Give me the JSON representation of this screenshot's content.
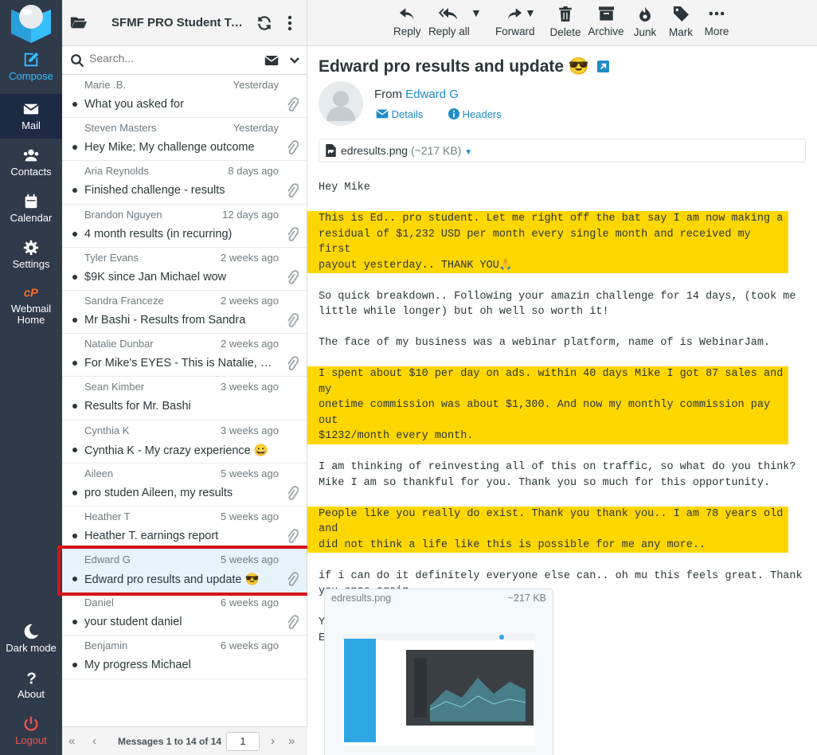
{
  "nav": {
    "items": [
      {
        "label": "Compose",
        "icon": "compose-icon"
      },
      {
        "label": "Mail",
        "icon": "envelope-icon"
      },
      {
        "label": "Contacts",
        "icon": "contacts-icon"
      },
      {
        "label": "Calendar",
        "icon": "calendar-icon"
      },
      {
        "label": "Settings",
        "icon": "gear-icon"
      },
      {
        "label": "Webmail Home",
        "icon": "cpanel-icon"
      }
    ],
    "bottom": [
      {
        "label": "Dark mode",
        "icon": "moon-icon"
      },
      {
        "label": "About",
        "icon": "question-icon"
      },
      {
        "label": "Logout",
        "icon": "power-icon"
      }
    ]
  },
  "list": {
    "folder_name": "SFMF PRO Student Testimonials",
    "search_placeholder": "Search...",
    "messages": [
      {
        "from": "Marie .B.",
        "date": "Yesterday",
        "subject": "What you asked for",
        "attachment": true
      },
      {
        "from": "Steven Masters",
        "date": "Yesterday",
        "subject": "Hey Mike; My challenge outcome",
        "attachment": true
      },
      {
        "from": "Aria Reynolds",
        "date": "8 days ago",
        "subject": "Finished challenge - results",
        "attachment": true
      },
      {
        "from": "Brandon Nguyen",
        "date": "12 days ago",
        "subject": "4 month results (in recurring)",
        "attachment": true
      },
      {
        "from": "Tyler Evans",
        "date": "2 weeks ago",
        "subject": "$9K since Jan Michael wow",
        "attachment": true
      },
      {
        "from": "Sandra Franceze",
        "date": "2 weeks ago",
        "subject": "Mr Bashi - Results from Sandra",
        "attachment": true
      },
      {
        "from": "Natalie Dunbar",
        "date": "2 weeks ago",
        "subject": "For Mike's EYES - This is Natalie, My results",
        "attachment": true
      },
      {
        "from": "Sean Kimber",
        "date": "3 weeks ago",
        "subject": "Results for Mr. Bashi",
        "attachment": false
      },
      {
        "from": "Cynthia K",
        "date": "3 weeks ago",
        "subject": "Cynthia K - My crazy experience 😀",
        "attachment": false
      },
      {
        "from": "Aileen",
        "date": "5 weeks ago",
        "subject": "pro studen Aileen, my results",
        "attachment": true
      },
      {
        "from": "Heather T",
        "date": "5 weeks ago",
        "subject": "Heather T. earnings report",
        "attachment": true
      },
      {
        "from": "Edward G",
        "date": "5 weeks ago",
        "subject": "Edward pro results and update 😎",
        "attachment": true,
        "selected": true
      },
      {
        "from": "Daniel",
        "date": "6 weeks ago",
        "subject": "your student daniel",
        "attachment": true
      },
      {
        "from": "Benjamin",
        "date": "6 weeks ago",
        "subject": "My progress Michael",
        "attachment": false
      }
    ],
    "footer": {
      "count_text": "Messages 1 to 14 of 14",
      "page": "1"
    }
  },
  "toolbar": {
    "buttons": [
      {
        "label": "Reply",
        "icon": "reply-icon"
      },
      {
        "label": "Reply all",
        "icon": "reply-all-icon"
      },
      {
        "label": "Forward",
        "icon": "forward-icon"
      },
      {
        "label": "Delete",
        "icon": "trash-icon"
      },
      {
        "label": "Archive",
        "icon": "archive-icon"
      },
      {
        "label": "Junk",
        "icon": "fire-icon"
      },
      {
        "label": "Mark",
        "icon": "tag-icon"
      },
      {
        "label": "More",
        "icon": "more-icon"
      }
    ]
  },
  "message": {
    "subject": "Edward pro results and update 😎",
    "from_label": "From",
    "from_name": "Edward G",
    "details_label": "Details",
    "headers_label": "Headers",
    "attachment_name": "edresults.png",
    "attachment_size": "(~217 KB)",
    "body": [
      {
        "text": "Hey Mike",
        "highlight": false
      },
      {
        "text": "This is Ed.. pro student. Let me right off the bat say I am now making a\nresidual of $1,232 USD per month every single month and received my first\npayout yesterday.. THANK YOU🙏",
        "highlight": true
      },
      {
        "text": "So quick breakdown.. Following your amazin challenge for 14 days, (took me\nlittle while longer) but oh well so worth it!",
        "highlight": false
      },
      {
        "text": "The face of my business was a webinar platform, name of is WebinarJam.",
        "highlight": false
      },
      {
        "text": "I spent about $10 per day on ads. within 40 days Mike I got 87 sales and my\nonetime commission was about $1,300. And now my monthly commission pay out\n$1232/month every month.",
        "highlight": true
      },
      {
        "text": "I am thinking of reinvesting all of this on traffic, so what do you think?\nMike I am so thankful for you. Thank you so much for this opportunity.",
        "highlight": false
      },
      {
        "text": "People like you really do exist. Thank you thank you.. I am 78 years old and\ndid not think a life like this is possible for me any more..",
        "highlight": true
      },
      {
        "text": "if i can do it definitely everyone else can.. oh mu this feels great. Thank\nyou once again..",
        "highlight": false
      },
      {
        "text": "Your forever fan;\nEd",
        "highlight": false
      }
    ],
    "attachment_card": {
      "name": "edresults.png",
      "size": "~217 KB"
    }
  },
  "colors": {
    "nav_bg": "#2f3a4a",
    "accent": "#37beff",
    "highlight": "#ffd700",
    "selection_border": "#d4131a"
  }
}
